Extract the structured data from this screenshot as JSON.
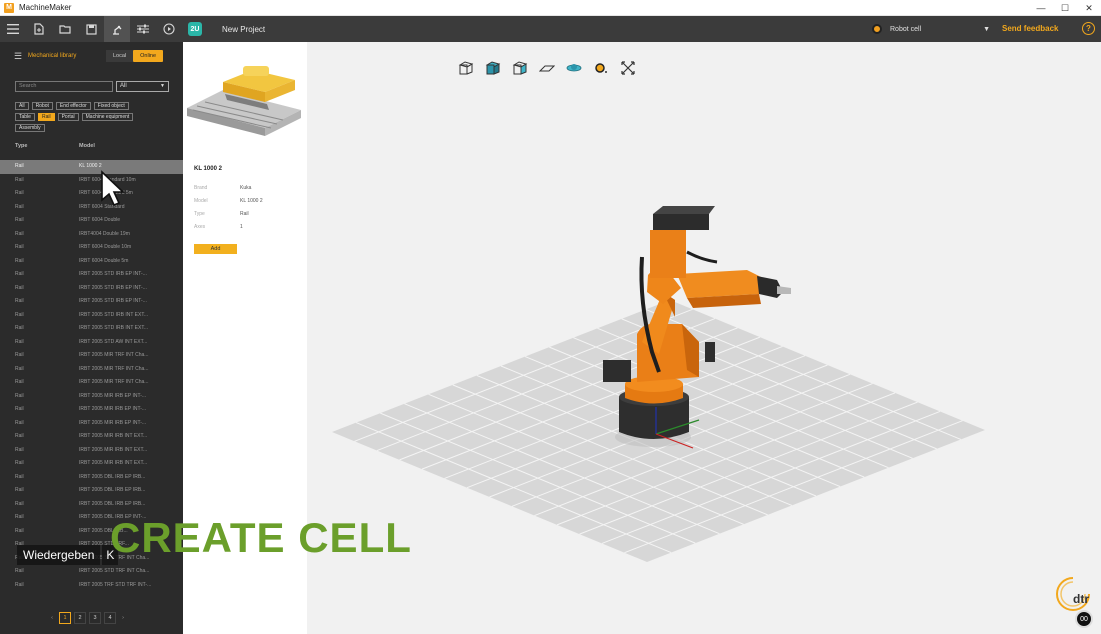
{
  "window": {
    "title": "MachineMaker",
    "minimize": "—",
    "maximize": "☐",
    "close": "✕"
  },
  "toolbar": {
    "project_name": "New Project",
    "cell_select": "Robot cell",
    "feedback": "Send feedback",
    "help": "?",
    "badge": "2U",
    "icons": [
      "menu-icon",
      "new-file-icon",
      "open-folder-icon",
      "save-icon",
      "robot-arm-icon",
      "settings-sliders-icon",
      "play-icon"
    ]
  },
  "library": {
    "title": "Mechanical library",
    "toggle_local": "Local",
    "toggle_online": "Online",
    "search_placeholder": "Search",
    "filter_value": "All",
    "chips_row1": [
      "All",
      "Robot",
      "End effector",
      "Fixed object"
    ],
    "chips_row2": [
      "Table",
      "Rail",
      "Portal",
      "Machine equipment"
    ],
    "chips_row3": [
      "Assembly"
    ],
    "active_chip": "Rail",
    "col_type": "Type",
    "col_model": "Model",
    "rows": [
      {
        "type": "Rail",
        "model": "KL 1000 2"
      },
      {
        "type": "Rail",
        "model": "IRBT 6004 Standard 10m"
      },
      {
        "type": "Rail",
        "model": "IRBT 6004 Standard 5m"
      },
      {
        "type": "Rail",
        "model": "IRBT 6004 Standard"
      },
      {
        "type": "Rail",
        "model": "IRBT 6004 Double"
      },
      {
        "type": "Rail",
        "model": "IRBT4004 Double 19m"
      },
      {
        "type": "Rail",
        "model": "IRBT 6004 Double 10m"
      },
      {
        "type": "Rail",
        "model": "IRBT 6004 Double 5m"
      },
      {
        "type": "Rail",
        "model": "IRBT 2005 STD IRB EP INT-..."
      },
      {
        "type": "Rail",
        "model": "IRBT 2005 STD IRB EP INT-..."
      },
      {
        "type": "Rail",
        "model": "IRBT 2005 STD IRB EP INT-..."
      },
      {
        "type": "Rail",
        "model": "IRBT 2005 STD IRB INT EXT..."
      },
      {
        "type": "Rail",
        "model": "IRBT 2005 STD IRB INT EXT..."
      },
      {
        "type": "Rail",
        "model": "IRBT 2005 STD AW INT EXT..."
      },
      {
        "type": "Rail",
        "model": "IRBT 2005 MIR TRF INT Cha..."
      },
      {
        "type": "Rail",
        "model": "IRBT 2005 MIR TRF INT Cha..."
      },
      {
        "type": "Rail",
        "model": "IRBT 2005 MIR TRF INT Cha..."
      },
      {
        "type": "Rail",
        "model": "IRBT 2005 MIR IRB EP INT-..."
      },
      {
        "type": "Rail",
        "model": "IRBT 2005 MIR IRB EP INT-..."
      },
      {
        "type": "Rail",
        "model": "IRBT 2005 MIR IRB EP INT-..."
      },
      {
        "type": "Rail",
        "model": "IRBT 2005 MIR IRB INT EXT..."
      },
      {
        "type": "Rail",
        "model": "IRBT 2005 MIR IRB INT EXT..."
      },
      {
        "type": "Rail",
        "model": "IRBT 2005 MIR IRB INT EXT..."
      },
      {
        "type": "Rail",
        "model": "IRBT 2005 DBL IRB EP IRB..."
      },
      {
        "type": "Rail",
        "model": "IRBT 2005 DBL IRB EP IRB..."
      },
      {
        "type": "Rail",
        "model": "IRBT 2005 DBL IRB EP IRB..."
      },
      {
        "type": "Rail",
        "model": "IRBT 2005 DBL IRB EP INT-..."
      },
      {
        "type": "Rail",
        "model": "IRBT 2005 DBL IRB..."
      },
      {
        "type": "Rail",
        "model": "IRBT 2005 STD TRF..."
      },
      {
        "type": "Rail",
        "model": "IRBT 2005 STD TRF INT Cha..."
      },
      {
        "type": "Rail",
        "model": "IRBT 2005 STD TRF INT Cha..."
      },
      {
        "type": "Rail",
        "model": "IRBT 2005 TRF STD TRF INT-..."
      }
    ],
    "pager": {
      "prev": "‹",
      "pages": [
        "1",
        "2",
        "3",
        "4"
      ],
      "next": "›",
      "active": "1"
    }
  },
  "details": {
    "title": "KL 1000 2",
    "fields": [
      {
        "key": "Brand",
        "value": "Kuka"
      },
      {
        "key": "Model",
        "value": "KL 1000 2"
      },
      {
        "key": "Type",
        "value": "Rail"
      },
      {
        "key": "Axes",
        "value": "1"
      }
    ],
    "add_label": "Add"
  },
  "viewport": {
    "tools": [
      "view-front-icon",
      "view-top-icon",
      "view-side-icon",
      "plane-icon",
      "orbit-icon",
      "robot-focus-icon",
      "fit-view-icon"
    ],
    "robot_color": "#e8841a",
    "floor_color": "#d7d7d7"
  },
  "overlay": {
    "play_label": "Wiedergeben",
    "play_key": "K",
    "caption": "CREATE CELL",
    "caption_color": "#6b9f2b",
    "brand": "dtr",
    "eye_badge": "00"
  }
}
